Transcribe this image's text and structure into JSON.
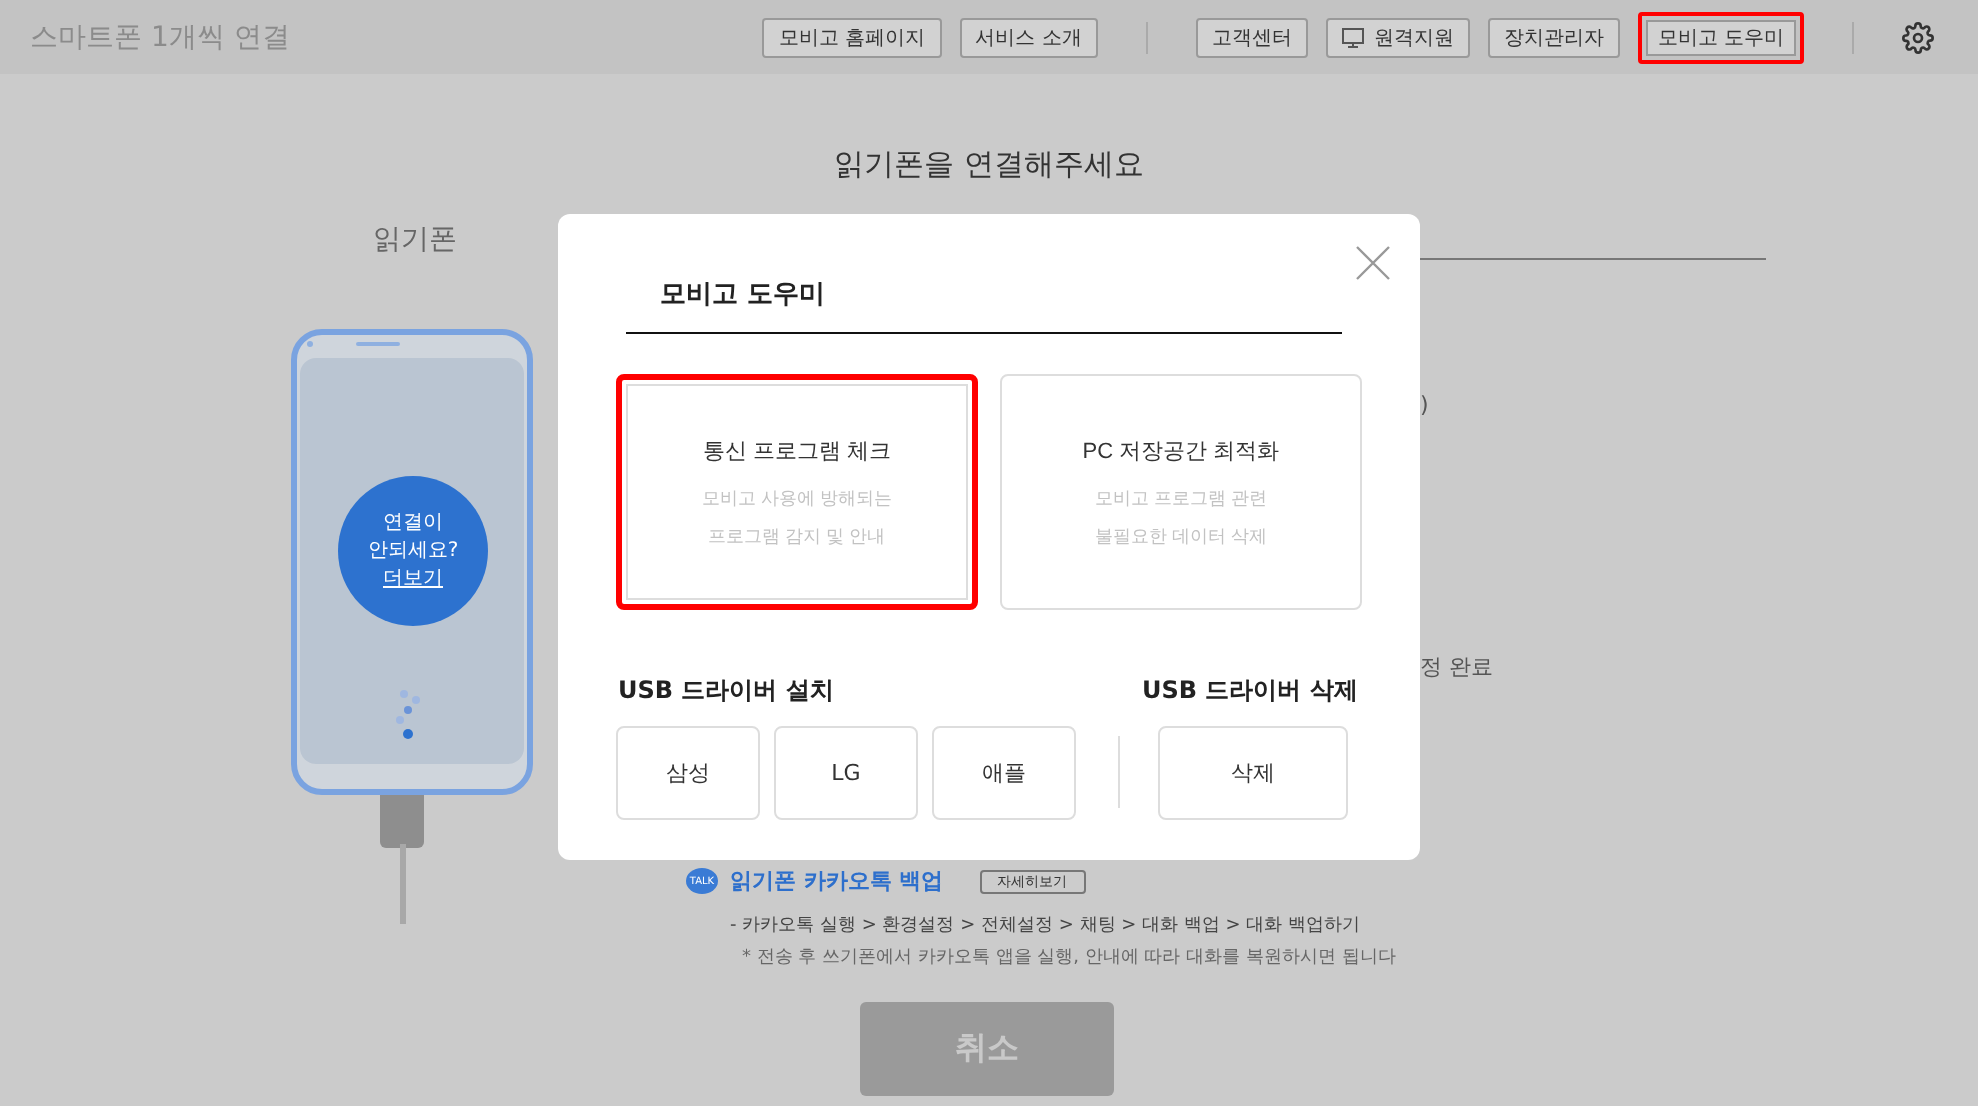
{
  "header": {
    "title": "스마트폰 1개씩 연결",
    "nav_groups": [
      [
        {
          "label": "모비고 홈페이지",
          "kind": "plain",
          "highlighted": false
        },
        {
          "label": "서비스 소개",
          "kind": "plain",
          "highlighted": false
        }
      ],
      [
        {
          "label": "고객센터",
          "kind": "plain",
          "highlighted": false
        },
        {
          "label": "원격지원",
          "kind": "remote",
          "highlighted": false
        },
        {
          "label": "장치관리자",
          "kind": "plain",
          "highlighted": false
        },
        {
          "label": "모비고 도우미",
          "kind": "plain",
          "highlighted": true
        }
      ]
    ]
  },
  "page": {
    "heading": "읽기폰을 연결해주세요",
    "phone_label": "읽기폰",
    "help": {
      "lines": [
        "연결이",
        "안되세요?"
      ],
      "link": "더보기"
    },
    "fragments": [
      ")",
      "정 완료"
    ],
    "kakao": {
      "badge": "TALK",
      "title": "읽기폰 카카오톡 백업",
      "button": "자세히보기",
      "steps": "- 카카오톡 실행 > 환경설정 > 전체설정 > 채팅 > 대화 백업 > 대화 백업하기",
      "note": "* 전송 후 쓰기폰에서 카카오톡 앱을 실행, 안내에 따라 대화를 복원하시면 됩니다"
    },
    "cancel_button": "취소"
  },
  "dialog": {
    "title": "모비고 도우미",
    "cards": [
      {
        "title": "통신 프로그램 체크",
        "description": [
          "모비고 사용에 방해되는",
          "프로그램 감지 및 안내"
        ],
        "highlighted": true
      },
      {
        "title": "PC 저장공간 최적화",
        "description": [
          "모비고 프로그램 관련",
          "불필요한 데이터 삭제"
        ],
        "highlighted": false
      }
    ],
    "sections": [
      {
        "title": "USB 드라이버 설치",
        "buttons": [
          "삼성",
          "LG",
          "애플"
        ]
      },
      {
        "title": "USB 드라이버 삭제",
        "buttons": [
          "삭제"
        ]
      }
    ]
  }
}
